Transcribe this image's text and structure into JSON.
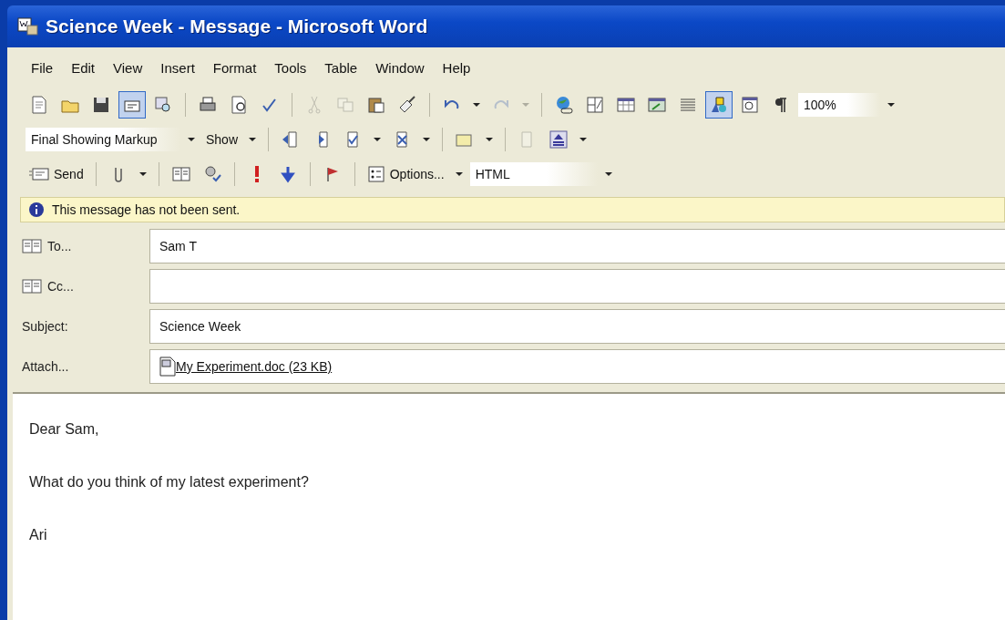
{
  "window": {
    "title": "Science Week - Message - Microsoft Word"
  },
  "menu": [
    "File",
    "Edit",
    "View",
    "Insert",
    "Format",
    "Tools",
    "Table",
    "Window",
    "Help"
  ],
  "standard_toolbar": {
    "buttons": [
      {
        "pressed": false,
        "disabled": false
      },
      {
        "pressed": false,
        "disabled": false
      },
      {
        "pressed": false,
        "disabled": false
      },
      {
        "pressed": true,
        "disabled": false
      },
      {
        "pressed": false,
        "disabled": false
      },
      {
        "pressed": false,
        "disabled": false
      },
      {
        "pressed": false,
        "disabled": false
      },
      {
        "pressed": false,
        "disabled": false
      },
      {
        "pressed": false,
        "disabled": true
      },
      {
        "pressed": false,
        "disabled": true
      },
      {
        "pressed": false,
        "disabled": false
      },
      {
        "pressed": false,
        "disabled": false
      },
      {
        "pressed": false,
        "disabled": false
      },
      {
        "pressed": false,
        "disabled": true
      },
      {
        "pressed": false,
        "disabled": false
      },
      {
        "pressed": false,
        "disabled": false
      },
      {
        "pressed": false,
        "disabled": false
      },
      {
        "pressed": false,
        "disabled": false
      },
      {
        "pressed": false,
        "disabled": false
      },
      {
        "pressed": true,
        "disabled": false
      },
      {
        "pressed": false,
        "disabled": false
      },
      {
        "pressed": false,
        "disabled": false
      }
    ],
    "zoom": "100%"
  },
  "reviewing_toolbar": {
    "display": "Final Showing Markup",
    "show": "Show"
  },
  "email_toolbar": {
    "send": "Send",
    "options": "Options...",
    "format": "HTML"
  },
  "info_bar": "This message has not been sent.",
  "fields": [
    {
      "kind": "address",
      "label": "To...",
      "value": "Sam T"
    },
    {
      "kind": "address",
      "label": "Cc..."
    },
    {
      "kind": "text",
      "label": "Subject:",
      "value": "Science Week"
    },
    {
      "kind": "attachment",
      "label": "Attach...",
      "value": "My Experiment.doc (23 KB)"
    }
  ],
  "body": [
    "Dear Sam,",
    "What do you think of my latest experiment?",
    "Ari"
  ]
}
